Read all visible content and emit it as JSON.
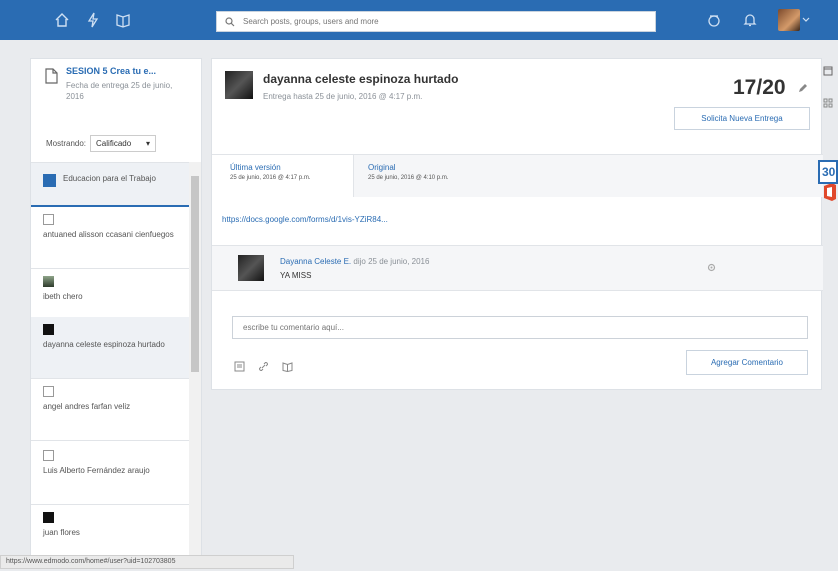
{
  "colors": {
    "brand": "#2a6cb3",
    "background": "#e9ebee",
    "office": "#e0482b"
  },
  "topnav": {
    "icons": [
      "home-icon",
      "activity-icon",
      "backpack-icon",
      "apps-icon",
      "bell-icon"
    ],
    "search_placeholder": "Search posts, groups, users and more"
  },
  "assignment": {
    "title": "SESION 5 Crea tu e...",
    "due": "Fecha de entrega 25 de junio, 2016"
  },
  "filter": {
    "label": "Mostrando:",
    "value": "Calificado"
  },
  "group": {
    "label": "Educacion para el Trabajo"
  },
  "students": [
    {
      "name": "antuaned alisson ccasani cienfuegos"
    },
    {
      "name": "ibeth chero"
    },
    {
      "name": "dayanna celeste espinoza hurtado"
    },
    {
      "name": "angel andres farfan veliz"
    },
    {
      "name": "Luis Alberto Fernández araujo"
    },
    {
      "name": "juan flores"
    }
  ],
  "submission": {
    "student_name": "dayanna celeste espinoza hurtado",
    "due_line": "Entrega hasta 25 de junio, 2016 @ 4:17 p.m.",
    "grade": "17/20",
    "resubmit_label": "Solicita Nueva Entrega",
    "tabs": [
      {
        "label": "Última versión",
        "date": "25 de junio, 2016 @ 4:17 p.m."
      },
      {
        "label": "Original",
        "date": "25 de junio, 2016 @ 4:10 p.m."
      }
    ],
    "link": "https://docs.google.com/forms/d/1vis-YZiR84..."
  },
  "comment": {
    "author": "Dayanna Celeste E.",
    "meta": "dijo 25 de junio, 2016",
    "text": "YA MISS"
  },
  "reply": {
    "placeholder": "escribe tu comentario aquí...",
    "button_label": "Agregar Comentario"
  },
  "rightbar": {
    "badge": "30"
  },
  "status_url": "https://www.edmodo.com/home#/user?uid=102703805"
}
